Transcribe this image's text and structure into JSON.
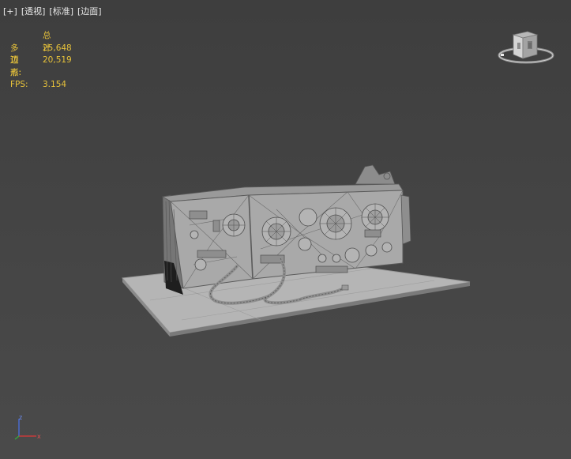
{
  "viewport": {
    "menu": [
      "[+]",
      "[透视]",
      "[标准]",
      "[边面]"
    ]
  },
  "stats": {
    "header": "总计",
    "polygons_label": "多边形:",
    "polygons_value": "25,648",
    "vertices_label": "顶点:",
    "vertices_value": "20,519",
    "fps_label": "FPS:",
    "fps_value": "3.154"
  },
  "colors": {
    "stats_text": "#e8c33a",
    "menu_text": "#e6e6e6",
    "background": "#444444",
    "model_fill": "#a8a8a8",
    "wire": "#5e5e5e"
  },
  "icons": {
    "viewcube": "viewcube-icon",
    "axis": "axis-gizmo-icon"
  }
}
